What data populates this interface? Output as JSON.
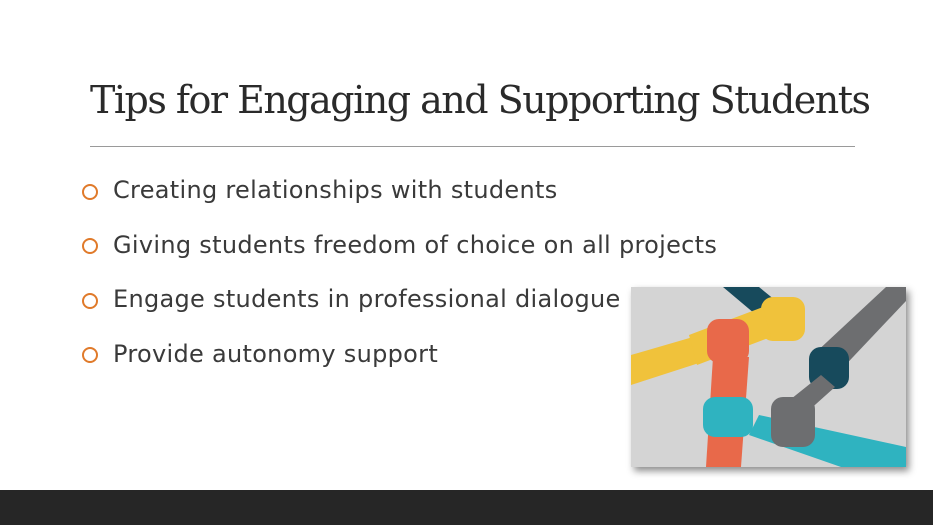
{
  "slide": {
    "title": "Tips for Engaging and Supporting Students",
    "bullets": [
      "Creating relationships with students",
      "Giving students freedom of choice on all projects",
      "Engage students in professional dialogue",
      "Provide autonomy support"
    ]
  },
  "colors": {
    "accent": "#e07a2a",
    "footer": "#262626",
    "yellow_arm": "#f0c23b",
    "orange_arm": "#e8694a",
    "teal_arm": "#2fb3c0",
    "gray_arm": "#6d6e70",
    "navy_arm": "#174a5c"
  },
  "image": {
    "icon": "joined-hands-teamwork-illustration"
  }
}
